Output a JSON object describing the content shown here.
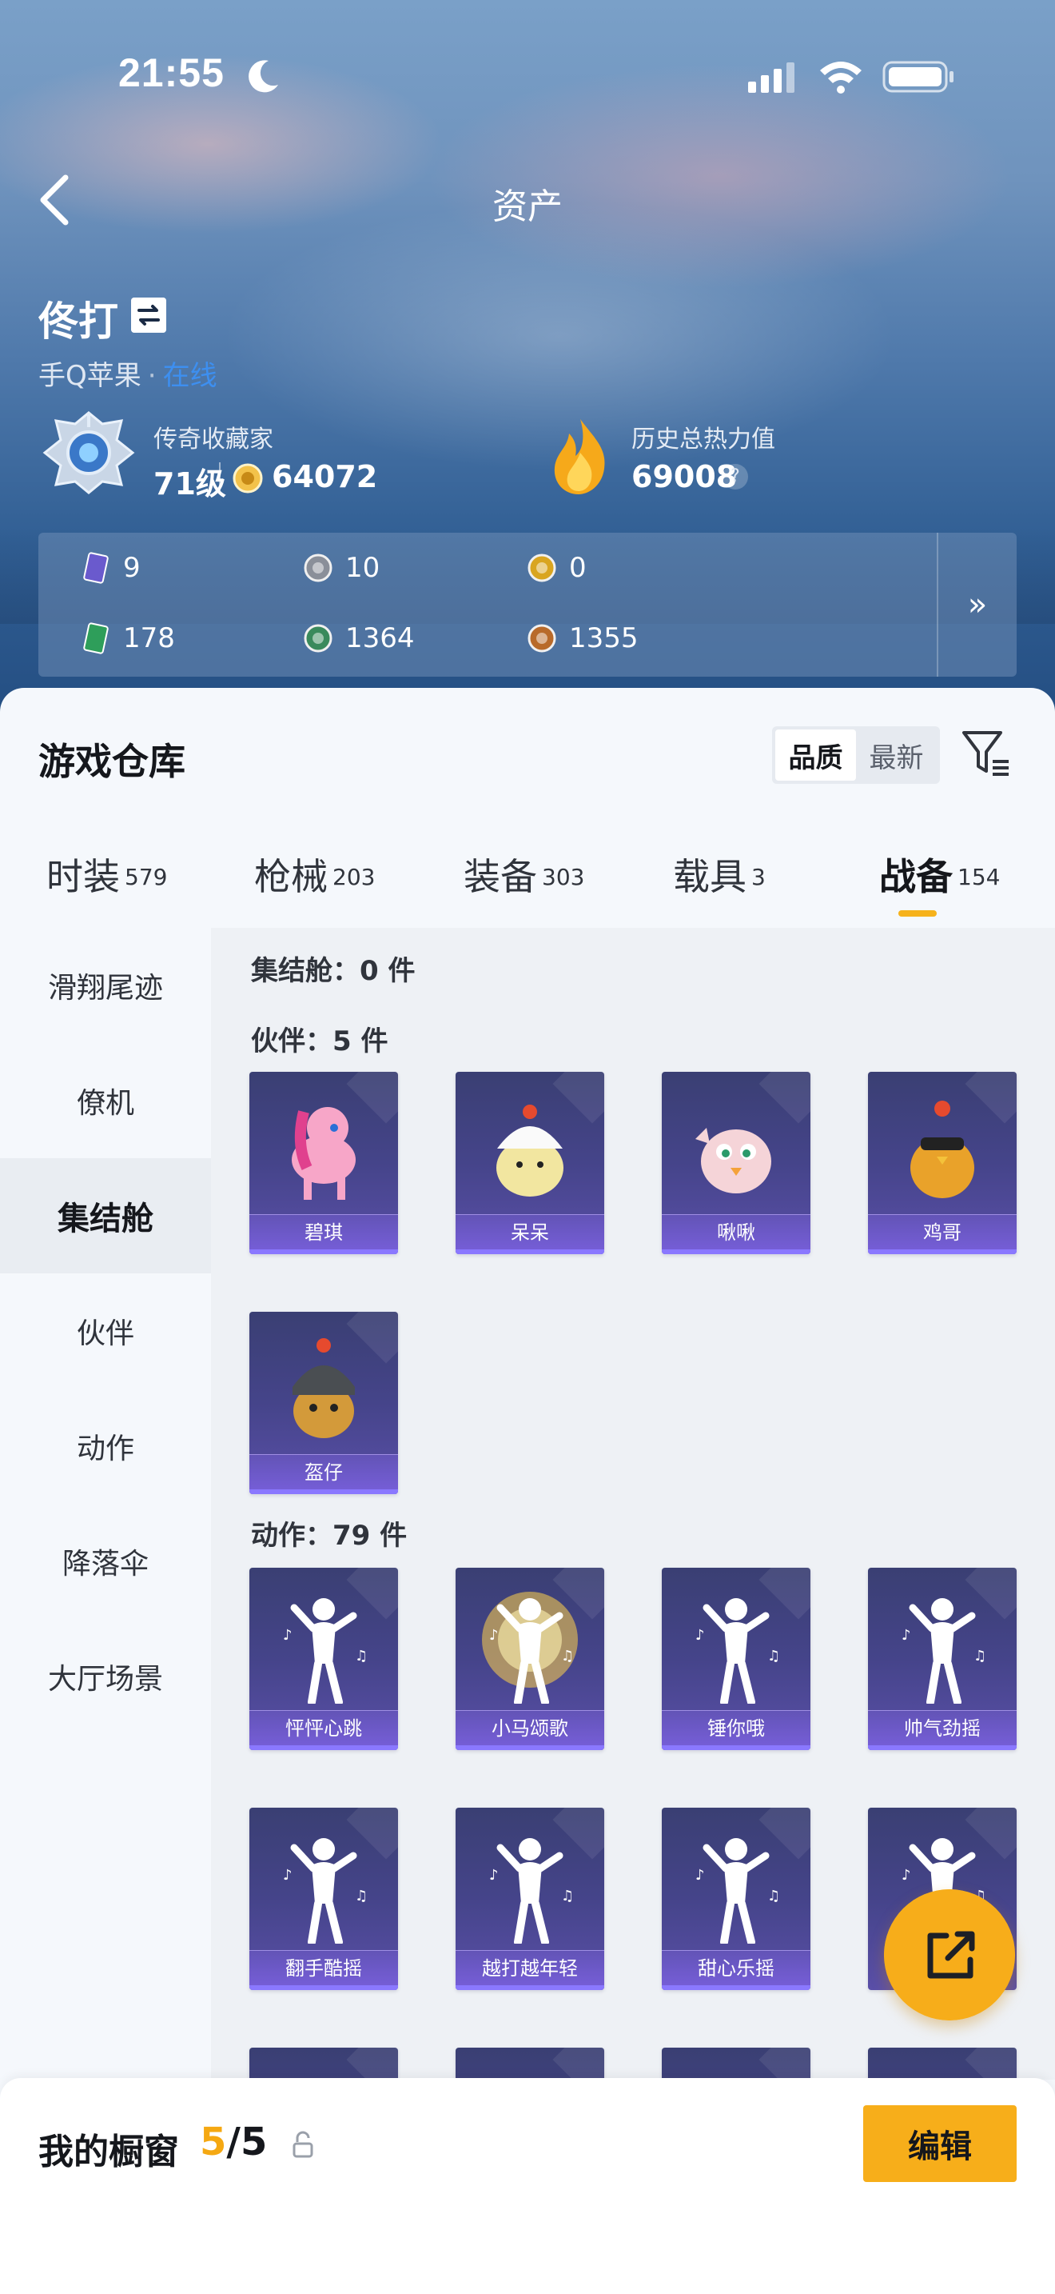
{
  "status_bar": {
    "time": "21:55"
  },
  "nav": {
    "title": "资产"
  },
  "profile": {
    "name": "佟打",
    "platform": "手Q苹果",
    "platform_sep": "·",
    "platform_link": "在线",
    "rank_label": "传奇收藏家",
    "rank_level": "71级",
    "coin_value": "64072",
    "heat_label": "历史总热力值",
    "heat_value": "69008",
    "help": "?"
  },
  "currencies": [
    {
      "icon": "card-icon",
      "value": "9",
      "color": "#6a5acd"
    },
    {
      "icon": "s-coin-icon",
      "value": "10",
      "color": "#8a8f99"
    },
    {
      "icon": "a-coin-icon",
      "value": "0",
      "color": "#d9a520"
    },
    {
      "icon": "green-card-icon",
      "value": "178",
      "color": "#2e9e5a"
    },
    {
      "icon": "green-orb-icon",
      "value": "1364",
      "color": "#3a8a5c"
    },
    {
      "icon": "bronze-coin-icon",
      "value": "1355",
      "color": "#b86a2a"
    }
  ],
  "currency_more": "»",
  "warehouse": {
    "title": "游戏仓库",
    "sort_options": [
      "品质",
      "最新"
    ],
    "sort_active": 0,
    "tabs": [
      {
        "label": "时装",
        "count": "579"
      },
      {
        "label": "枪械",
        "count": "203"
      },
      {
        "label": "装备",
        "count": "303"
      },
      {
        "label": "载具",
        "count": "3"
      },
      {
        "label": "战备",
        "count": "154"
      }
    ],
    "active_tab": 4,
    "sidebar": [
      "滑翔尾迹",
      "僚机",
      "集结舱",
      "伙伴",
      "动作",
      "降落伞",
      "大厅场景"
    ],
    "sidebar_active": 2,
    "sections": [
      {
        "title": "集结舱：0 件",
        "items": []
      },
      {
        "title": "伙伴：5 件",
        "items": [
          "碧琪",
          "呆呆",
          "啾啾",
          "鸡哥",
          "盔仔"
        ]
      },
      {
        "title": "动作：79 件",
        "items": [
          "怦怦心跳",
          "小马颂歌",
          "锤你哦",
          "帅气劲摇",
          "翻手酷摇",
          "越打越年轻",
          "甜心乐摇",
          ""
        ]
      }
    ]
  },
  "showcase": {
    "label": "我的橱窗",
    "current": "5",
    "slash": "/",
    "total": "5",
    "edit": "编辑"
  },
  "colors": {
    "accent": "#f5a812",
    "card_purple": "#45448a",
    "link_blue": "#3d8ff0"
  }
}
